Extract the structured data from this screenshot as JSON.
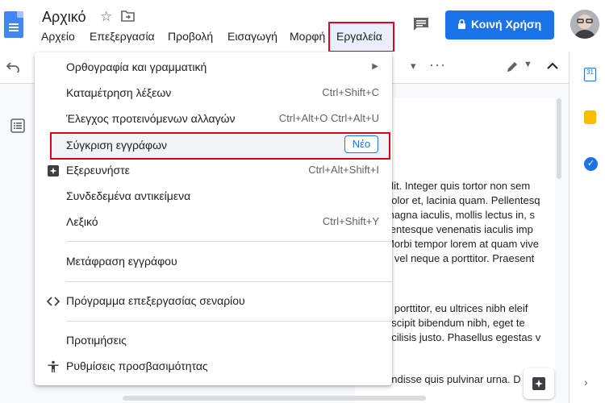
{
  "header": {
    "doc_title": "Αρχικό",
    "share_label": "Κοινή Χρήση"
  },
  "menubar": {
    "items": [
      "Αρχείο",
      "Επεξεργασία",
      "Προβολή",
      "Εισαγωγή",
      "Μορφή",
      "Εργαλεία"
    ]
  },
  "tools_menu": {
    "items": [
      {
        "label": "Ορθογραφία και γραμματική",
        "shortcut": "",
        "submenu": true
      },
      {
        "label": "Καταμέτρηση λέξεων",
        "shortcut": "Ctrl+Shift+C"
      },
      {
        "label": "Έλεγχος προτεινόμενων αλλαγών",
        "shortcut": "Ctrl+Alt+O Ctrl+Alt+U"
      },
      {
        "label": "Σύγκριση εγγράφων",
        "badge": "Νέο"
      },
      {
        "label": "Εξερευνήστε",
        "shortcut": "Ctrl+Alt+Shift+I",
        "icon": "explore-icon"
      },
      {
        "label": "Συνδεδεμένα αντικείμενα",
        "shortcut": ""
      },
      {
        "label": "Λεξικό",
        "shortcut": "Ctrl+Shift+Y"
      },
      {
        "label": "Μετάφραση εγγράφου",
        "shortcut": ""
      },
      {
        "label": "Πρόγραμμα επεξεργασίας σεναρίου",
        "shortcut": "",
        "icon": "code-icon"
      },
      {
        "label": "Προτιμήσεις",
        "shortcut": ""
      },
      {
        "label": "Ρυθμίσεις προσβασιμότητας",
        "shortcut": "",
        "icon": "accessibility-icon"
      }
    ]
  },
  "document": {
    "lines": [
      "elit. Integer quis tortor non sem",
      "dolor et, lacinia quam. Pellentesq",
      "magna iaculis, mollis lectus in, s",
      "llentesque venenatis iaculis imp",
      "Morbi tempor lorem at quam vive",
      "a vel neque a porttitor. Praesent",
      "a porttitor, eu ultrices nibh eleif",
      "uscipit bibendum nibh, eget te",
      "acilisis justo. Phasellus egestas v",
      "endisse quis pulvinar urna. D"
    ]
  },
  "side_panel": {
    "calendar_day": "31"
  },
  "colors": {
    "accent": "#1a73e8",
    "highlight_border": "#e0001b",
    "keep": "#fbbc04"
  }
}
